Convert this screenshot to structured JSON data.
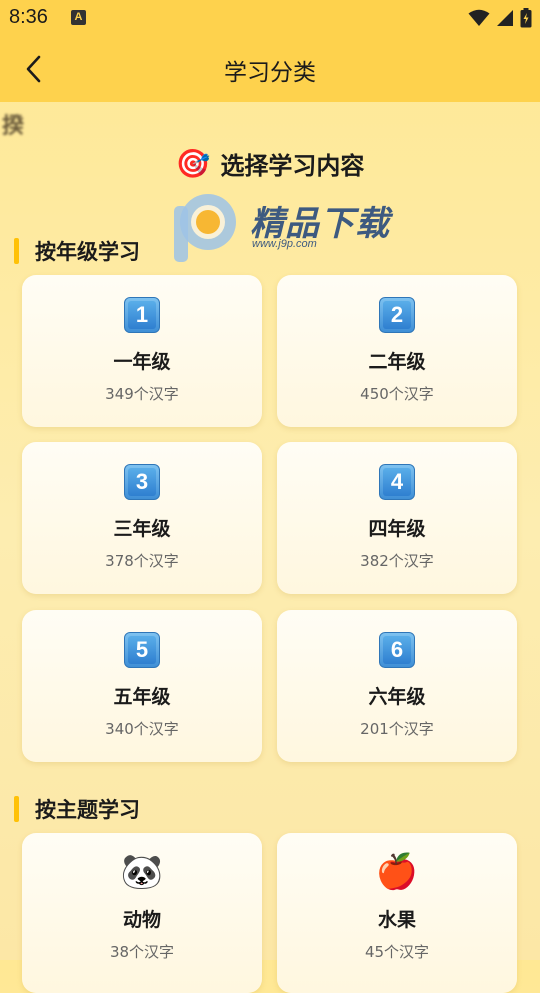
{
  "status_bar": {
    "time": "8:36",
    "notification_icon": "A"
  },
  "header": {
    "title": "学习分类"
  },
  "corner_tag": "揆",
  "page_heading": "选择学习内容",
  "watermark": {
    "brand": "精品下载",
    "url": "www.j9p.com"
  },
  "sections": {
    "grade": {
      "title": "按年级学习",
      "cards": [
        {
          "key": "1",
          "name": "一年级",
          "count": "349个汉字"
        },
        {
          "key": "2",
          "name": "二年级",
          "count": "450个汉字"
        },
        {
          "key": "3",
          "name": "三年级",
          "count": "378个汉字"
        },
        {
          "key": "4",
          "name": "四年级",
          "count": "382个汉字"
        },
        {
          "key": "5",
          "name": "五年级",
          "count": "340个汉字"
        },
        {
          "key": "6",
          "name": "六年级",
          "count": "201个汉字"
        }
      ]
    },
    "theme": {
      "title": "按主题学习",
      "cards": [
        {
          "icon": "🐼",
          "icon_name": "panda-icon",
          "name": "动物",
          "count": "38个汉字"
        },
        {
          "icon": "🍎",
          "icon_name": "apple-icon",
          "name": "水果",
          "count": "45个汉字"
        }
      ]
    }
  },
  "colors": {
    "header_bg": "#FED24D",
    "section_accent": "#FFC107",
    "key_blue": "#3F8FD6"
  }
}
